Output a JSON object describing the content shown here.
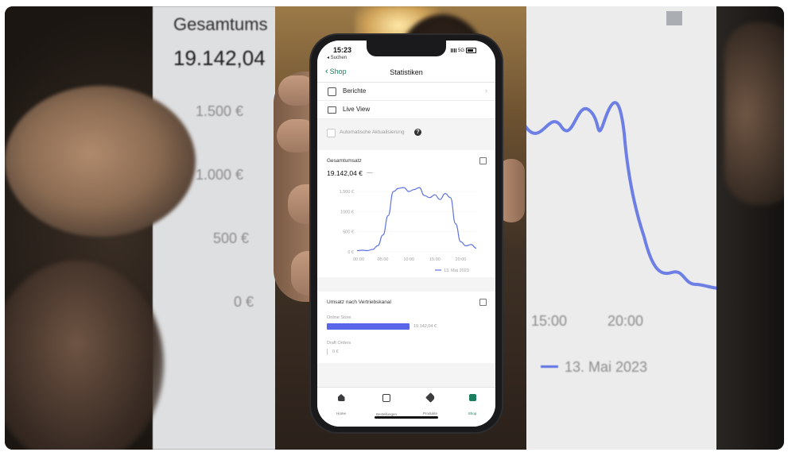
{
  "background_left": {
    "heading": "Gesamtums",
    "value": "19.142,04",
    "ticks": [
      "1.500 €",
      "1.000 €",
      "500 €",
      "0 €"
    ]
  },
  "background_right": {
    "ticks": [
      "15:00",
      "20:00"
    ],
    "legend": "13. Mai 2023"
  },
  "phone": {
    "status": {
      "time": "15:23",
      "back": "◂ Suchen",
      "network": "5G"
    },
    "nav": {
      "back_label": "Shop",
      "title": "Statistiken"
    },
    "menu": [
      {
        "label": "Berichte",
        "icon": "report-icon"
      },
      {
        "label": "Live View",
        "icon": "monitor-icon"
      }
    ],
    "auto_refresh": {
      "label": "Automatische Aktualisierung",
      "checked": false
    },
    "revenue_card": {
      "title": "Gesamtumsatz",
      "value": "19.142,04 €",
      "dash": "—",
      "legend": "13. Mai 2023"
    },
    "channel_card": {
      "title": "Umsatz nach Vertriebskanal",
      "channels": [
        {
          "name": "Online Store",
          "value": "19.142,04 €",
          "fraction": 1.0
        },
        {
          "name": "Draft Orders",
          "value": "0 €",
          "fraction": 0.0
        }
      ]
    },
    "tabs": [
      {
        "label": "Home",
        "icon": "home-icon",
        "active": false
      },
      {
        "label": "Bestellungen",
        "icon": "orders-icon",
        "active": false
      },
      {
        "label": "Produkte",
        "icon": "tag-icon",
        "active": false
      },
      {
        "label": "Shop",
        "icon": "store-icon",
        "active": true
      }
    ]
  },
  "chart_data": {
    "type": "line",
    "x_ticks": [
      "00:00",
      "05:00",
      "10:00",
      "15:00",
      "20:00"
    ],
    "y_ticks": [
      "1.500 €",
      "1000 €",
      "500 €",
      "0 €"
    ],
    "ylim": [
      0,
      1700
    ],
    "series": [
      {
        "name": "13. Mai 2023",
        "color": "#5f73e3",
        "x_hours": [
          0,
          1,
          2,
          3,
          4,
          5,
          6,
          7,
          8,
          9,
          10,
          11,
          12,
          13,
          14,
          15,
          16,
          17,
          18,
          19,
          20,
          21,
          22,
          23
        ],
        "values": [
          30,
          40,
          30,
          60,
          150,
          420,
          900,
          1500,
          1580,
          1600,
          1500,
          1550,
          1600,
          1400,
          1350,
          1420,
          1300,
          1450,
          1350,
          700,
          250,
          150,
          180,
          90
        ]
      }
    ]
  }
}
